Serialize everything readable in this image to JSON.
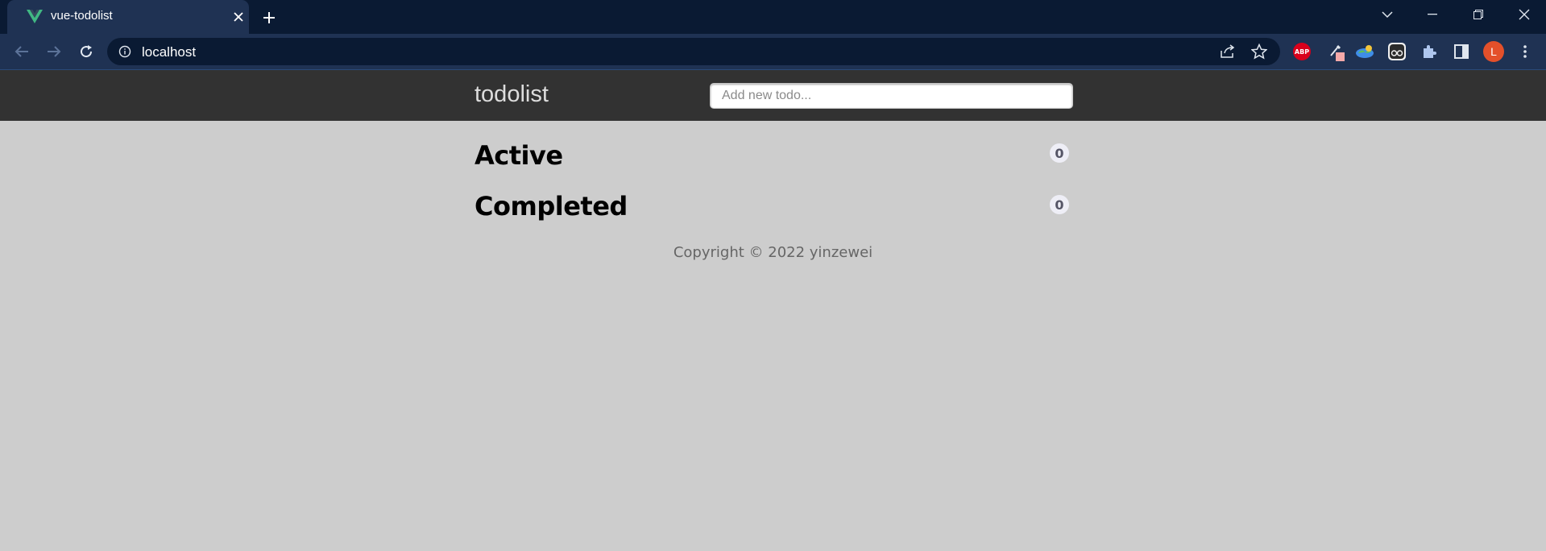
{
  "browser": {
    "tab": {
      "title": "vue-todolist",
      "favicon": "vue-logo-icon"
    },
    "url": "localhost",
    "profile_initial": "L",
    "extensions": [
      "abp-icon",
      "eyedropper-icon",
      "earth-icon",
      "glasses-icon",
      "puzzle-icon"
    ],
    "extension_labels": {
      "abp": "ABP"
    },
    "colors": {
      "tabstrip": "#0a1a33",
      "toolbar": "#1f3253",
      "avatar": "#e4502a"
    }
  },
  "app": {
    "title": "todolist",
    "input": {
      "placeholder": "Add new todo...",
      "value": ""
    },
    "sections": [
      {
        "label": "Active",
        "count": "0"
      },
      {
        "label": "Completed",
        "count": "0"
      }
    ],
    "footer": "Copyright © 2022 yinzewei",
    "colors": {
      "header": "#323232",
      "body": "#cdcdcd"
    }
  }
}
